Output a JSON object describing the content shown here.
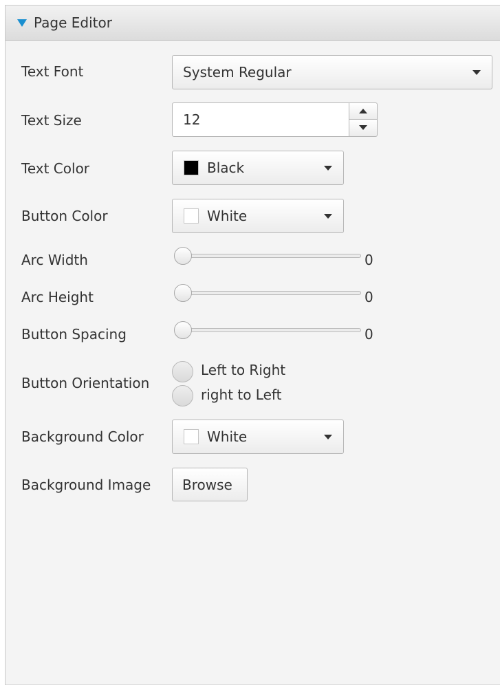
{
  "panel": {
    "title": "Page Editor",
    "accent_color": "#1a8fd0"
  },
  "text_font": {
    "label": "Text Font",
    "value": "System Regular"
  },
  "text_size": {
    "label": "Text Size",
    "value": "12"
  },
  "text_color": {
    "label": "Text Color",
    "value": "Black",
    "swatch": "#000000"
  },
  "button_color": {
    "label": "Button Color",
    "value": "White",
    "swatch": "#ffffff"
  },
  "arc_width": {
    "label": "Arc Width",
    "value": "0"
  },
  "arc_height": {
    "label": "Arc Height",
    "value": "0"
  },
  "button_spacing": {
    "label": "Button Spacing",
    "value": "0"
  },
  "button_orientation": {
    "label": "Button Orientation",
    "options": [
      "Left to Right",
      "right to Left"
    ]
  },
  "background_color": {
    "label": "Background Color",
    "value": "White",
    "swatch": "#ffffff"
  },
  "background_image": {
    "label": "Background Image",
    "button": "Browse"
  }
}
